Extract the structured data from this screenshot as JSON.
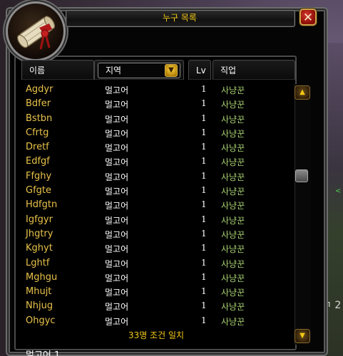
{
  "window": {
    "title": "누구 목록",
    "close_glyph": "✕"
  },
  "columns": {
    "name": "이름",
    "zone_dropdown": "지역",
    "level": "Lv",
    "class": "직업"
  },
  "rows": [
    {
      "name": "Agdyr",
      "zone": "멀고어",
      "level": "1",
      "class": "사냥꾼"
    },
    {
      "name": "Bdfer",
      "zone": "멀고어",
      "level": "1",
      "class": "사냥꾼"
    },
    {
      "name": "Bstbn",
      "zone": "멀고어",
      "level": "1",
      "class": "사냥꾼"
    },
    {
      "name": "Cfrtg",
      "zone": "멀고어",
      "level": "1",
      "class": "사냥꾼"
    },
    {
      "name": "Dretf",
      "zone": "멀고어",
      "level": "1",
      "class": "사냥꾼"
    },
    {
      "name": "Edfgf",
      "zone": "멀고어",
      "level": "1",
      "class": "사냥꾼"
    },
    {
      "name": "Ffghy",
      "zone": "멀고어",
      "level": "1",
      "class": "사냥꾼"
    },
    {
      "name": "Gfgte",
      "zone": "멀고어",
      "level": "1",
      "class": "사냥꾼"
    },
    {
      "name": "Hdfgtn",
      "zone": "멀고어",
      "level": "1",
      "class": "사냥꾼"
    },
    {
      "name": "Igfgyr",
      "zone": "멀고어",
      "level": "1",
      "class": "사냥꾼"
    },
    {
      "name": "Jhgtry",
      "zone": "멀고어",
      "level": "1",
      "class": "사냥꾼"
    },
    {
      "name": "Kghyt",
      "zone": "멀고어",
      "level": "1",
      "class": "사냥꾼"
    },
    {
      "name": "Lghtf",
      "zone": "멀고어",
      "level": "1",
      "class": "사냥꾼"
    },
    {
      "name": "Mghgu",
      "zone": "멀고어",
      "level": "1",
      "class": "사냥꾼"
    },
    {
      "name": "Mhujt",
      "zone": "멀고어",
      "level": "1",
      "class": "사냥꾼"
    },
    {
      "name": "Nhjug",
      "zone": "멀고어",
      "level": "1",
      "class": "사냥꾼"
    },
    {
      "name": "Ohgyc",
      "zone": "멀고어",
      "level": "1",
      "class": "사냥꾼"
    }
  ],
  "footer": {
    "match_count": "33명 조건 일치"
  },
  "bottom_text": "멀고어 1",
  "background_text": "ㄱ 2",
  "icons": {
    "portrait": "scroll-portrait-icon",
    "dropdown_arrow": "arrow-down-icon",
    "scroll_up": "scroll-up-icon",
    "scroll_down": "scroll-down-icon"
  },
  "colors": {
    "title": "#f3c815",
    "name": "#e8c24a",
    "class": "#aad372",
    "close": "#b81e14"
  }
}
